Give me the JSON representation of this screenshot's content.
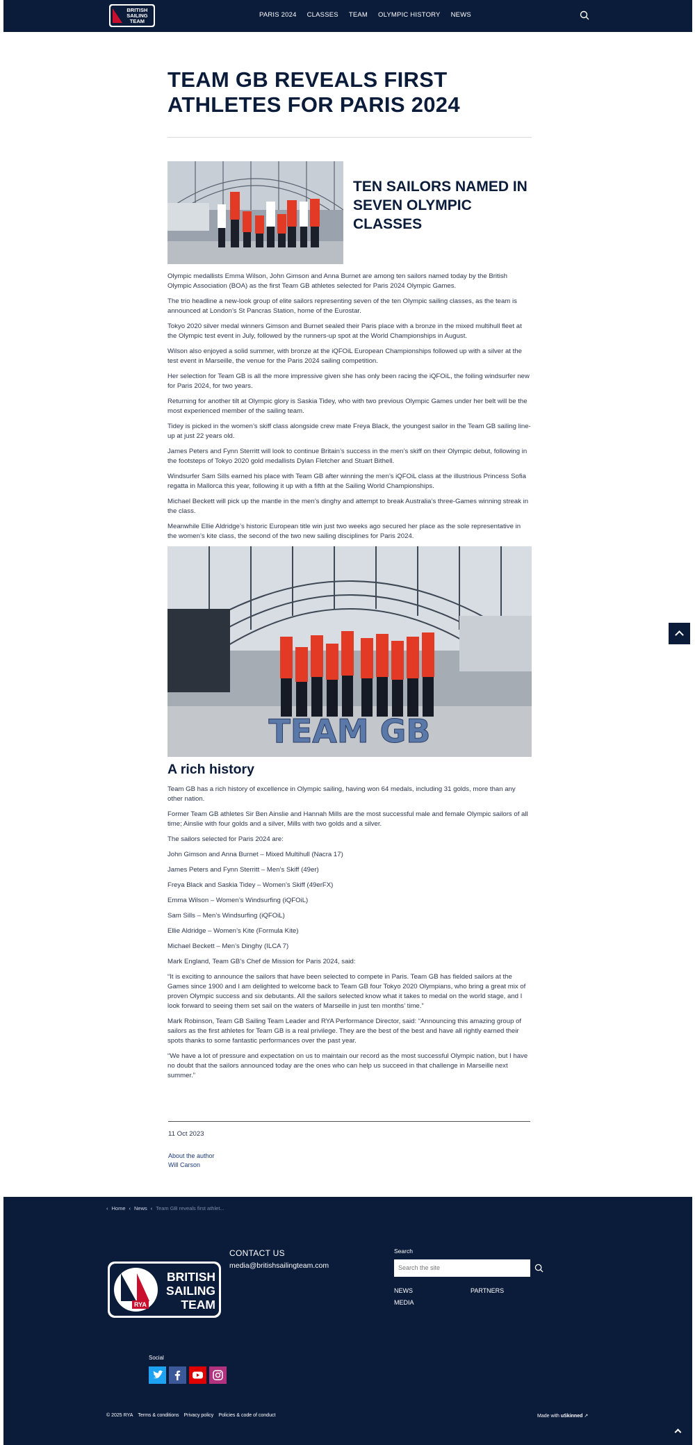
{
  "header": {
    "logo_text": "BRITISH SAILING TEAM",
    "nav": [
      "PARIS 2024",
      "CLASSES",
      "TEAM",
      "OLYMPIC HISTORY",
      "NEWS"
    ]
  },
  "article": {
    "title": "TEAM GB REVEALS FIRST ATHLETES FOR PARIS 2024",
    "subhead": "TEN SAILORS NAMED IN SEVEN OLYMPIC CLASSES",
    "paragraphs": [
      "Olympic medallists Emma Wilson, John Gimson and Anna Burnet are among ten sailors named today by the British Olympic Association (BOA) as the first Team GB athletes selected for Paris 2024 Olympic Games.",
      "The trio headline a new-look group of elite sailors representing seven of the ten Olympic sailing classes, as the team is announced at London’s St Pancras Station, home of the Eurostar.",
      "Tokyo 2020 silver medal winners Gimson and Burnet sealed their Paris place with a bronze in the mixed multihull fleet at the Olympic test event in July, followed by the runners-up spot at the World Championships in August.",
      "Wilson also enjoyed a solid summer, with bronze at the iQFOiL European Championships followed up with a silver at the test event in Marseille, the venue for the Paris 2024 sailing competition.",
      "Her selection for Team GB is all the more impressive given she has only been racing the iQFOiL, the foiling windsurfer new for Paris 2024, for two years.",
      "Returning for another tilt at Olympic glory is Saskia Tidey, who with two previous Olympic Games under her belt will be the most experienced member of the sailing team.",
      "Tidey is picked in the women’s skiff class alongside crew mate Freya Black, the youngest sailor in the Team GB sailing line-up at just 22 years old.",
      "James Peters and Fynn Sterritt will look to continue Britain’s success in the men’s skiff on their Olympic debut, following in the footsteps of Tokyo 2020 gold medallists Dylan Fletcher and Stuart Bithell.",
      "Windsurfer Sam Sills earned his place with Team GB after winning the men’s iQFOiL class at the illustrious Princess Sofia regatta in Mallorca this year, following it up with a fifth at the Sailing World Championships.",
      "Michael Beckett will pick up the mantle in the men’s dinghy and attempt to break Australia’s three-Games winning streak in the class.",
      "Meanwhile Ellie Aldridge’s historic European title win just two weeks ago secured her place as the sole representative in the women’s kite class, the second of the two new sailing disciplines for Paris 2024."
    ],
    "image_overlay_text": "TEAM GB",
    "history_heading": "A rich history",
    "history_paragraphs": [
      "Team GB has a rich history of excellence in Olympic sailing, having won 64 medals, including 31 golds, more than any other nation.",
      "Former Team GB athletes Sir Ben Ainslie and Hannah Mills are the most successful male and female Olympic sailors of all time; Ainslie with four golds and a silver, Mills with two golds and a silver.",
      "The sailors selected for Paris 2024 are:",
      "John Gimson and Anna Burnet – Mixed Multihull (Nacra 17)",
      "James Peters and Fynn Sterritt – Men’s Skiff (49er)",
      "Freya Black and Saskia Tidey – Women’s Skiff (49erFX)",
      "Emma Wilson – Women’s Windsurfing (iQFOiL)",
      "Sam Sills – Men’s Windsurfing (iQFOiL)",
      "Ellie Aldridge – Women’s Kite (Formula Kite)",
      "Michael Beckett – Men’s Dinghy (ILCA 7)",
      "Mark England, Team GB’s Chef de Mission for Paris 2024, said:",
      "“It is exciting to announce the sailors that have been selected to compete in Paris. Team GB has fielded sailors at the Games since 1900 and I am delighted to welcome back to Team GB four Tokyo 2020 Olympians, who bring a great mix of proven Olympic success and six debutants. All the sailors selected know what it takes to medal on the world stage, and I look forward to seeing them set sail on the waters of Marseille in just ten months’ time.”",
      "Mark Robinson, Team GB Sailing Team Leader and RYA Performance Director, said: “Announcing this amazing group of sailors as the first athletes for Team GB is a real privilege. They are the best of the best and have all rightly earned their spots thanks to some fantastic performances over the past year.",
      "“We have a lot of pressure and expectation on us to maintain our record as the most successful Olympic nation, but I have no doubt that the sailors announced today are the ones who can help us succeed in that challenge in Marseille next summer.”"
    ],
    "date": "11 Oct 2023",
    "about_label": "About the author",
    "author": "Will Carson"
  },
  "footer": {
    "breadcrumbs": [
      "Home",
      "News",
      "Team GB reveals first athlet..."
    ],
    "logo_text": "BRITISH SAILING TEAM",
    "logo_badge": "RYA",
    "contact_heading": "CONTACT US",
    "contact_email": "media@britishsailingteam.com",
    "search_label": "Search",
    "search_placeholder": "Search the site",
    "links": [
      "NEWS",
      "PARTNERS",
      "MEDIA"
    ],
    "social_label": "Social",
    "social_icons": [
      "twitter-icon",
      "facebook-icon",
      "youtube-icon",
      "instagram-icon"
    ],
    "social_colors": [
      "#1da1f2",
      "#3b5998",
      "#e00000",
      "#b1327e"
    ],
    "legal": [
      "© 2025 RYA",
      "Terms & conditions",
      "Privacy policy",
      "Policies & code of conduct"
    ],
    "made_with_prefix": "Made with",
    "made_with_brand": "uSkinned"
  }
}
